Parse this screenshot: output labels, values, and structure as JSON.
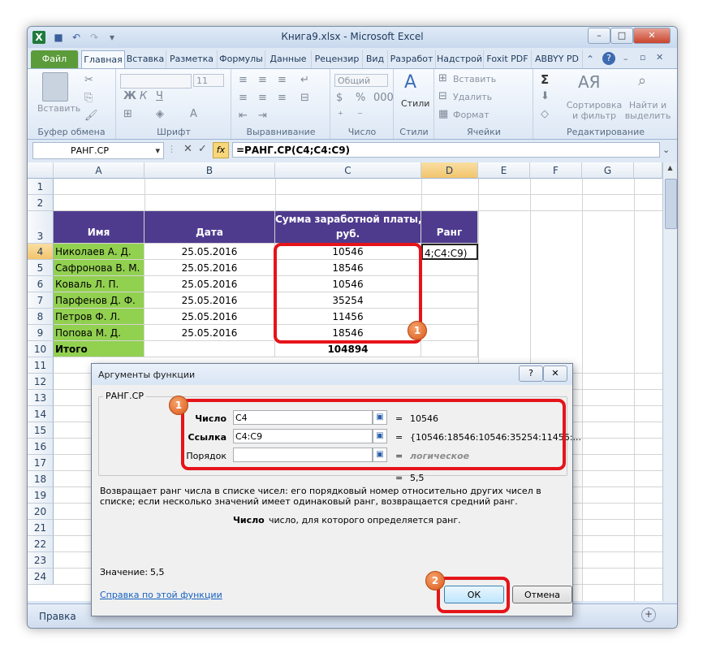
{
  "window": {
    "title": "Книга9.xlsx  -  Microsoft Excel",
    "controls": {
      "minimize": "–",
      "restore": "□",
      "close": "✕"
    }
  },
  "ribbon": {
    "tabs": [
      "Файл",
      "Главная",
      "Вставка",
      "Разметка",
      "Формулы",
      "Данные",
      "Рецензир",
      "Вид",
      "Разработ",
      "Надстрой",
      "Foxit PDF",
      "ABBYY PD"
    ],
    "active_tab": "Главная",
    "groups": {
      "clipboard": {
        "label": "Буфер обмена",
        "paste": "Вставить"
      },
      "font": {
        "label": "Шрифт",
        "size": "11",
        "bold": "Ж",
        "italic": "К",
        "underline": "Ч"
      },
      "alignment": {
        "label": "Выравнивание"
      },
      "number": {
        "label": "Число",
        "format": "Общий"
      },
      "styles": {
        "label": "Стили",
        "button": "Стили"
      },
      "cells": {
        "label": "Ячейки",
        "insert": "Вставить",
        "delete": "Удалить",
        "format": "Формат"
      },
      "editing": {
        "label": "Редактирование",
        "sort": "Сортировка\nи фильтр",
        "find": "Найти и\nвыделить",
        "sum": "Σ"
      }
    }
  },
  "formula_bar": {
    "name_box": "РАНГ.СР",
    "formula": "=РАНГ.СР(C4;C4:C9)",
    "fx": "fx"
  },
  "sheet": {
    "columns": [
      "A",
      "B",
      "C",
      "D",
      "E",
      "F",
      "G"
    ],
    "rows": [
      "1",
      "2",
      "3",
      "4",
      "5",
      "6",
      "7",
      "8",
      "9",
      "10",
      "11",
      "12",
      "13",
      "14",
      "15",
      "16",
      "17",
      "18",
      "19",
      "20",
      "21",
      "22",
      "23",
      "24"
    ],
    "headers": {
      "name": "Имя",
      "date": "Дата",
      "salary_line1": "Сумма заработной платы,",
      "salary_line2": "руб.",
      "rank": "Ранг"
    },
    "data": [
      {
        "name": "Николаев А. Д.",
        "date": "25.05.2016",
        "salary": "10546",
        "rank": "4;C4:C9)"
      },
      {
        "name": "Сафронова В. М.",
        "date": "25.05.2016",
        "salary": "18546",
        "rank": ""
      },
      {
        "name": "Коваль Л. П.",
        "date": "25.05.2016",
        "salary": "10546",
        "rank": ""
      },
      {
        "name": "Парфенов Д. Ф.",
        "date": "25.05.2016",
        "salary": "35254",
        "rank": ""
      },
      {
        "name": "Петров Ф. Л.",
        "date": "25.05.2016",
        "salary": "11456",
        "rank": ""
      },
      {
        "name": "Попова М. Д.",
        "date": "25.05.2016",
        "salary": "18546",
        "rank": ""
      }
    ],
    "total": {
      "label": "Итого",
      "value": "104894"
    }
  },
  "status": {
    "text": "Правка"
  },
  "dialog": {
    "title": "Аргументы функции",
    "help": "?",
    "close": "✕",
    "function_name": "РАНГ.СР",
    "args": [
      {
        "label": "Число",
        "value": "C4",
        "result": "10546",
        "bold": true
      },
      {
        "label": "Ссылка",
        "value": "C4:C9",
        "result": "{10546:18546:10546:35254:11456:...",
        "bold": true
      },
      {
        "label": "Порядок",
        "value": "",
        "result": "логическое",
        "bold": false
      }
    ],
    "eq": "=",
    "result_line": "5,5",
    "description": "Возвращает ранг числа в списке чисел: его порядковый номер относительно других чисел в списке; если несколько значений имеет одинаковый ранг, возвращается средний ранг.",
    "arg_help_name": "Число",
    "arg_help_text": "число, для которого определяется ранг.",
    "value_label": "Значение:",
    "value": "5,5",
    "help_link": "Справка по этой функции",
    "ok": "ОК",
    "cancel": "Отмена"
  },
  "callouts": {
    "one": "1",
    "two": "2"
  },
  "colors": {
    "header_fill": "#4f3b8e",
    "name_fill": "#92d050",
    "callout": "#e5141b",
    "badge": "#e8732f"
  }
}
